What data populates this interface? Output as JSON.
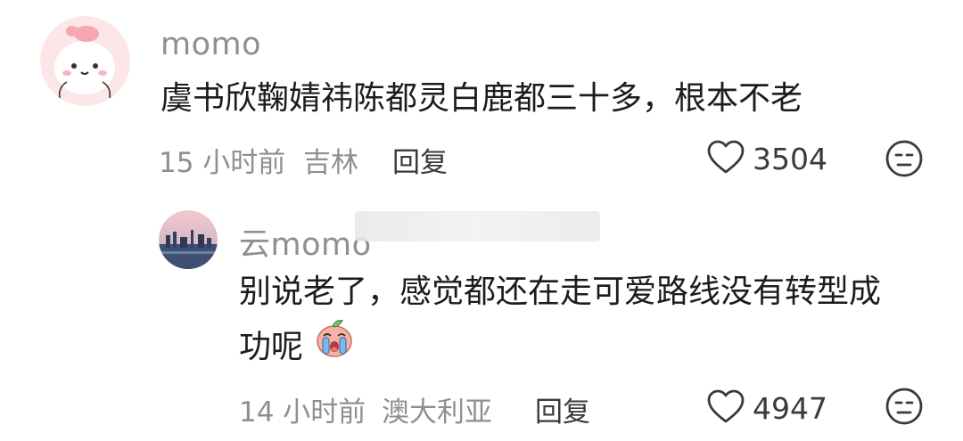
{
  "comments": [
    {
      "username": "momo",
      "text": "虞书欣鞠婧祎陈都灵白鹿都三十多，根本不老",
      "time": "15 小时前",
      "location": "吉林",
      "reply_label": "回复",
      "likes": "3504"
    },
    {
      "username": "云momo",
      "text_line1": "别说老了，感觉都还在走可爱路线没有转型成",
      "text_line2": "功呢",
      "time": "14 小时前",
      "location": "澳大利亚",
      "reply_label": "回复",
      "likes": "4947"
    }
  ],
  "icons": {
    "like": "heart-outline-icon",
    "dislike": "unamused-face-icon",
    "emoji": "crying-peach-emoji"
  },
  "colors": {
    "meta_gray": "#8f8f8f",
    "text": "#1c1c1c",
    "avatar1_bg": "#fde4e6"
  }
}
